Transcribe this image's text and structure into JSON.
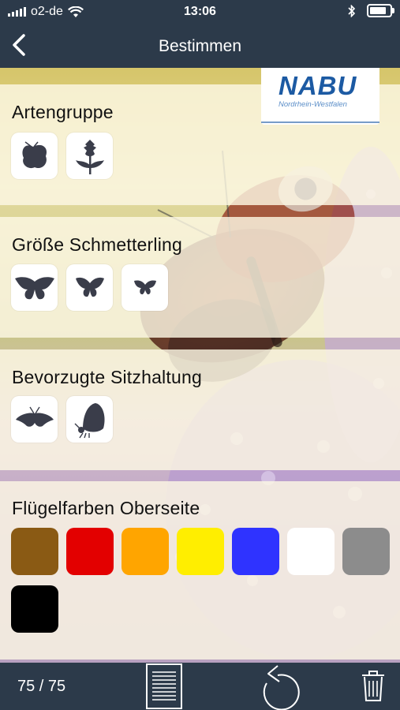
{
  "status_bar": {
    "carrier": "o2-de",
    "time": "13:06"
  },
  "nav": {
    "title": "Bestimmen",
    "back_icon": "chevron-left-icon"
  },
  "logo": {
    "word": "NABU",
    "region": "Nordrhein-Westfalen"
  },
  "sections": {
    "artengruppe": {
      "title": "Artengruppe",
      "options": [
        "butterfly-icon",
        "thistle-plant-icon"
      ]
    },
    "groesse": {
      "title": "Größe Schmetterling",
      "options": [
        "large-butterfly-icon",
        "medium-butterfly-icon",
        "small-butterfly-icon"
      ]
    },
    "sitzhaltung": {
      "title": "Bevorzugte Sitzhaltung",
      "options": [
        "wings-open-icon",
        "wings-closed-icon"
      ]
    },
    "fluegelfarben": {
      "title": "Flügelfarben Oberseite",
      "colors": [
        "#8a5a14",
        "#e30000",
        "#ffa500",
        "#ffee00",
        "#2f33ff",
        "#ffffff",
        "#8c8c8c",
        "#000000"
      ]
    }
  },
  "toolbar": {
    "count": "75 / 75",
    "icons": [
      "document-list-icon",
      "undo-icon",
      "trash-icon"
    ]
  }
}
